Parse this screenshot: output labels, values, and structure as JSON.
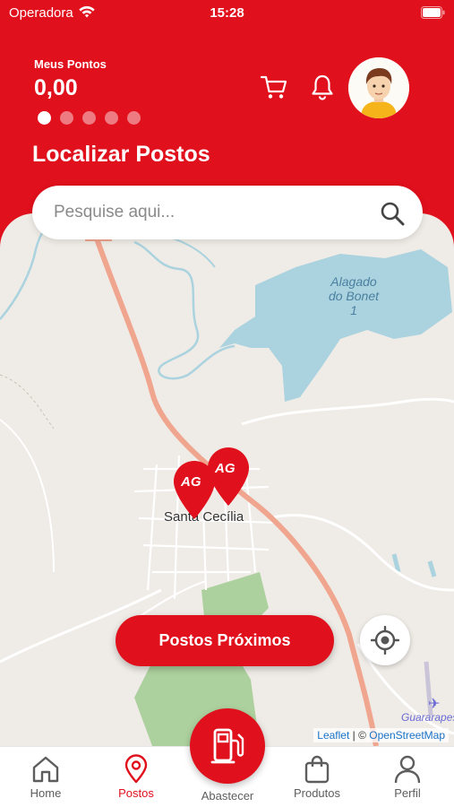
{
  "status_bar": {
    "carrier": "Operadora",
    "time": "15:28"
  },
  "header": {
    "points_label": "Meus Pontos",
    "points_value": "0,00",
    "carousel_dots": 5,
    "carousel_active_index": 0,
    "title": "Localizar Postos"
  },
  "search": {
    "placeholder": "Pesquise aqui..."
  },
  "map": {
    "place_label": "Santa Cecília",
    "lake_label_line1": "Alagado",
    "lake_label_line2": "do Bonet",
    "lake_label_line3": "1",
    "airport_label": "Guararapes",
    "marker_logo_text": "AG",
    "attribution_leaflet": "Leaflet",
    "attribution_separator": " | © ",
    "attribution_osm": "OpenStreetMap"
  },
  "actions": {
    "nearby_button": "Postos Próximos"
  },
  "tabbar": {
    "home": "Home",
    "postos": "Postos",
    "abastecer": "Abastecer",
    "produtos": "Produtos",
    "perfil": "Perfil"
  },
  "icons": {
    "wifi": "wifi-icon",
    "battery": "battery-icon",
    "cart": "cart-icon",
    "bell": "bell-icon",
    "search": "search-icon",
    "locate": "crosshair-icon",
    "home": "home-icon",
    "postos": "map-pin-icon",
    "abastecer": "fuel-pump-icon",
    "produtos": "shopping-bag-icon",
    "perfil": "user-icon"
  },
  "colors": {
    "brand": "#e0101c",
    "map_water": "#aad3df",
    "map_road": "#f0a58f",
    "map_green": "#add19e"
  }
}
